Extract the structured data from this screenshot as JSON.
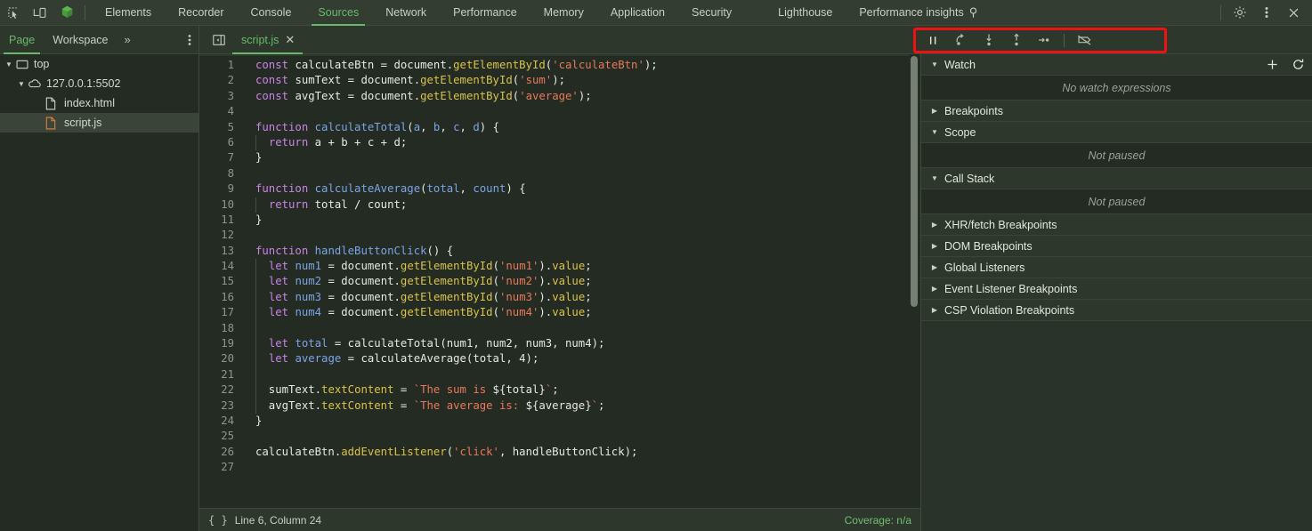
{
  "topbar": {
    "icons": [
      {
        "name": "inspect-element-icon",
        "label": "Inspect element"
      },
      {
        "name": "device-toolbar-icon",
        "label": "Toggle device toolbar"
      },
      {
        "name": "chrome-extension-hexagon-icon",
        "label": "Extension"
      }
    ],
    "tabs": [
      {
        "label": "Elements",
        "active": false
      },
      {
        "label": "Recorder",
        "active": false
      },
      {
        "label": "Console",
        "active": false
      },
      {
        "label": "Sources",
        "active": true
      },
      {
        "label": "Network",
        "active": false
      },
      {
        "label": "Performance",
        "active": false
      },
      {
        "label": "Memory",
        "active": false
      },
      {
        "label": "Application",
        "active": false
      },
      {
        "label": "Security",
        "active": false
      },
      {
        "label": "Lighthouse",
        "active": false
      },
      {
        "label": "Performance insights",
        "active": false,
        "badge": "⚲"
      }
    ],
    "right_icons": [
      {
        "name": "settings-gear-icon",
        "label": "Settings"
      },
      {
        "name": "more-options-kebab-icon",
        "label": "Customize and control DevTools"
      },
      {
        "name": "close-devtools-icon",
        "label": "Close DevTools"
      }
    ]
  },
  "navigator_tabs": {
    "tabs": [
      {
        "label": "Page",
        "active": true
      },
      {
        "label": "Workspace",
        "active": false
      }
    ],
    "overflow_label": "»",
    "more_icon": "more-options-kebab-icon"
  },
  "editor_tabs": {
    "panel_toggle_icon": "show-navigator-panel-icon",
    "open_files": [
      {
        "label": "script.js",
        "active": true,
        "close_icon": "✕"
      }
    ]
  },
  "debug_toolbar": {
    "highlighted": true,
    "highlight_color": "#ef1212",
    "buttons": [
      {
        "name": "pause-script-execution-button",
        "label": "Pause script execution",
        "glyph": "pause",
        "active": true
      },
      {
        "name": "step-over-next-function-call-button",
        "label": "Step over next function call",
        "glyph": "step-over",
        "active": false
      },
      {
        "name": "step-into-next-function-call-button",
        "label": "Step into next function call",
        "glyph": "step-into",
        "active": false
      },
      {
        "name": "step-out-of-current-function-button",
        "label": "Step out of current function",
        "glyph": "step-out",
        "active": false
      },
      {
        "name": "step-button",
        "label": "Step",
        "glyph": "step",
        "active": false
      },
      {
        "name": "deactivate-breakpoints-button",
        "label": "Deactivate breakpoints",
        "glyph": "deactivate-breakpoints",
        "active": false
      }
    ]
  },
  "navigator_tree": [
    {
      "label": "top",
      "icon": "frame-icon",
      "depth": 0,
      "twisty": "▼",
      "selected": false
    },
    {
      "label": "127.0.0.1:5502",
      "icon": "cloud-icon",
      "depth": 1,
      "twisty": "▼",
      "selected": false
    },
    {
      "label": "index.html",
      "icon": "html-file-icon",
      "depth": 2,
      "twisty": "",
      "selected": false
    },
    {
      "label": "script.js",
      "icon": "js-file-icon",
      "depth": 2,
      "twisty": "",
      "selected": true
    }
  ],
  "code": {
    "filename": "script.js",
    "total_lines": 27,
    "lines": [
      {
        "n": 1,
        "indent": 0,
        "tokens": [
          [
            "k",
            "const"
          ],
          [
            "pl",
            " "
          ],
          [
            "id",
            "calculateBtn"
          ],
          [
            "pl",
            " = "
          ],
          [
            "id",
            "document"
          ],
          [
            "pl",
            "."
          ],
          [
            "fn",
            "getElementById"
          ],
          [
            "pl",
            "("
          ],
          [
            "st",
            "'calculateBtn'"
          ],
          [
            "pl",
            ");"
          ]
        ]
      },
      {
        "n": 2,
        "indent": 0,
        "tokens": [
          [
            "k",
            "const"
          ],
          [
            "pl",
            " "
          ],
          [
            "id",
            "sumText"
          ],
          [
            "pl",
            " = "
          ],
          [
            "id",
            "document"
          ],
          [
            "pl",
            "."
          ],
          [
            "fn",
            "getElementById"
          ],
          [
            "pl",
            "("
          ],
          [
            "st",
            "'sum'"
          ],
          [
            "pl",
            ");"
          ]
        ]
      },
      {
        "n": 3,
        "indent": 0,
        "tokens": [
          [
            "k",
            "const"
          ],
          [
            "pl",
            " "
          ],
          [
            "id",
            "avgText"
          ],
          [
            "pl",
            " = "
          ],
          [
            "id",
            "document"
          ],
          [
            "pl",
            "."
          ],
          [
            "fn",
            "getElementById"
          ],
          [
            "pl",
            "("
          ],
          [
            "st",
            "'average'"
          ],
          [
            "pl",
            ");"
          ]
        ]
      },
      {
        "n": 4,
        "indent": 0,
        "tokens": []
      },
      {
        "n": 5,
        "indent": 0,
        "tokens": [
          [
            "k",
            "function"
          ],
          [
            "pl",
            " "
          ],
          [
            "vr",
            "calculateTotal"
          ],
          [
            "pl",
            "("
          ],
          [
            "vr",
            "a"
          ],
          [
            "pl",
            ", "
          ],
          [
            "vr",
            "b"
          ],
          [
            "pl",
            ", "
          ],
          [
            "vr",
            "c"
          ],
          [
            "pl",
            ", "
          ],
          [
            "vr",
            "d"
          ],
          [
            "pl",
            ") {"
          ]
        ]
      },
      {
        "n": 6,
        "indent": 1,
        "tokens": [
          [
            "pl",
            "  "
          ],
          [
            "k",
            "return"
          ],
          [
            "pl",
            " a + b + c + d;"
          ]
        ]
      },
      {
        "n": 7,
        "indent": 0,
        "tokens": [
          [
            "pl",
            "}"
          ]
        ]
      },
      {
        "n": 8,
        "indent": 0,
        "tokens": []
      },
      {
        "n": 9,
        "indent": 0,
        "tokens": [
          [
            "k",
            "function"
          ],
          [
            "pl",
            " "
          ],
          [
            "vr",
            "calculateAverage"
          ],
          [
            "pl",
            "("
          ],
          [
            "vr",
            "total"
          ],
          [
            "pl",
            ", "
          ],
          [
            "vr",
            "count"
          ],
          [
            "pl",
            ") {"
          ]
        ]
      },
      {
        "n": 10,
        "indent": 1,
        "tokens": [
          [
            "pl",
            "  "
          ],
          [
            "k",
            "return"
          ],
          [
            "pl",
            " total / count;"
          ]
        ]
      },
      {
        "n": 11,
        "indent": 0,
        "tokens": [
          [
            "pl",
            "}"
          ]
        ]
      },
      {
        "n": 12,
        "indent": 0,
        "tokens": []
      },
      {
        "n": 13,
        "indent": 0,
        "tokens": [
          [
            "k",
            "function"
          ],
          [
            "pl",
            " "
          ],
          [
            "vr",
            "handleButtonClick"
          ],
          [
            "pl",
            "() {"
          ]
        ]
      },
      {
        "n": 14,
        "indent": 1,
        "tokens": [
          [
            "pl",
            "  "
          ],
          [
            "k",
            "let"
          ],
          [
            "pl",
            " "
          ],
          [
            "vr",
            "num1"
          ],
          [
            "pl",
            " = "
          ],
          [
            "id",
            "document"
          ],
          [
            "pl",
            "."
          ],
          [
            "fn",
            "getElementById"
          ],
          [
            "pl",
            "("
          ],
          [
            "st",
            "'num1'"
          ],
          [
            "pl",
            ")."
          ],
          [
            "fn",
            "value"
          ],
          [
            "pl",
            ";"
          ]
        ]
      },
      {
        "n": 15,
        "indent": 1,
        "tokens": [
          [
            "pl",
            "  "
          ],
          [
            "k",
            "let"
          ],
          [
            "pl",
            " "
          ],
          [
            "vr",
            "num2"
          ],
          [
            "pl",
            " = "
          ],
          [
            "id",
            "document"
          ],
          [
            "pl",
            "."
          ],
          [
            "fn",
            "getElementById"
          ],
          [
            "pl",
            "("
          ],
          [
            "st",
            "'num2'"
          ],
          [
            "pl",
            ")."
          ],
          [
            "fn",
            "value"
          ],
          [
            "pl",
            ";"
          ]
        ]
      },
      {
        "n": 16,
        "indent": 1,
        "tokens": [
          [
            "pl",
            "  "
          ],
          [
            "k",
            "let"
          ],
          [
            "pl",
            " "
          ],
          [
            "vr",
            "num3"
          ],
          [
            "pl",
            " = "
          ],
          [
            "id",
            "document"
          ],
          [
            "pl",
            "."
          ],
          [
            "fn",
            "getElementById"
          ],
          [
            "pl",
            "("
          ],
          [
            "st",
            "'num3'"
          ],
          [
            "pl",
            ")."
          ],
          [
            "fn",
            "value"
          ],
          [
            "pl",
            ";"
          ]
        ]
      },
      {
        "n": 17,
        "indent": 1,
        "tokens": [
          [
            "pl",
            "  "
          ],
          [
            "k",
            "let"
          ],
          [
            "pl",
            " "
          ],
          [
            "vr",
            "num4"
          ],
          [
            "pl",
            " = "
          ],
          [
            "id",
            "document"
          ],
          [
            "pl",
            "."
          ],
          [
            "fn",
            "getElementById"
          ],
          [
            "pl",
            "("
          ],
          [
            "st",
            "'num4'"
          ],
          [
            "pl",
            ")."
          ],
          [
            "fn",
            "value"
          ],
          [
            "pl",
            ";"
          ]
        ]
      },
      {
        "n": 18,
        "indent": 1,
        "tokens": []
      },
      {
        "n": 19,
        "indent": 1,
        "tokens": [
          [
            "pl",
            "  "
          ],
          [
            "k",
            "let"
          ],
          [
            "pl",
            " "
          ],
          [
            "vr",
            "total"
          ],
          [
            "pl",
            " = calculateTotal(num1, num2, num3, num4);"
          ]
        ]
      },
      {
        "n": 20,
        "indent": 1,
        "tokens": [
          [
            "pl",
            "  "
          ],
          [
            "k",
            "let"
          ],
          [
            "pl",
            " "
          ],
          [
            "vr",
            "average"
          ],
          [
            "pl",
            " = calculateAverage(total, 4);"
          ]
        ]
      },
      {
        "n": 21,
        "indent": 1,
        "tokens": []
      },
      {
        "n": 22,
        "indent": 1,
        "tokens": [
          [
            "pl",
            "  sumText."
          ],
          [
            "fn",
            "textContent"
          ],
          [
            "pl",
            " = "
          ],
          [
            "st",
            "`The sum is "
          ],
          [
            "pl",
            "${total}"
          ],
          [
            "st",
            "`"
          ],
          [
            "pl",
            ";"
          ]
        ]
      },
      {
        "n": 23,
        "indent": 1,
        "tokens": [
          [
            "pl",
            "  avgText."
          ],
          [
            "fn",
            "textContent"
          ],
          [
            "pl",
            " = "
          ],
          [
            "st",
            "`The average is: "
          ],
          [
            "pl",
            "${average}"
          ],
          [
            "st",
            "`"
          ],
          [
            "pl",
            ";"
          ]
        ]
      },
      {
        "n": 24,
        "indent": 0,
        "tokens": [
          [
            "pl",
            "}"
          ]
        ]
      },
      {
        "n": 25,
        "indent": 0,
        "tokens": []
      },
      {
        "n": 26,
        "indent": 0,
        "tokens": [
          [
            "pl",
            "calculateBtn."
          ],
          [
            "fn",
            "addEventListener"
          ],
          [
            "pl",
            "("
          ],
          [
            "st",
            "'click'"
          ],
          [
            "pl",
            ", handleButtonClick);"
          ]
        ]
      },
      {
        "n": 27,
        "indent": 0,
        "tokens": []
      }
    ]
  },
  "statusbar": {
    "pretty_print_icon": "{ }",
    "position": "Line 6, Column 24",
    "coverage": "Coverage: n/a"
  },
  "debugger_panel": {
    "sections": [
      {
        "name": "watch",
        "label": "Watch",
        "twisty": "▼",
        "expanded": true,
        "actions": [
          {
            "name": "add-watch-expression-button",
            "glyph": "plus"
          },
          {
            "name": "refresh-watch-expressions-button",
            "glyph": "refresh"
          }
        ],
        "empty_text": "No watch expressions"
      },
      {
        "name": "breakpoints",
        "label": "Breakpoints",
        "twisty": "▶",
        "expanded": false
      },
      {
        "name": "scope",
        "label": "Scope",
        "twisty": "▼",
        "expanded": true,
        "empty_text": "Not paused"
      },
      {
        "name": "call-stack",
        "label": "Call Stack",
        "twisty": "▼",
        "expanded": true,
        "empty_text": "Not paused"
      },
      {
        "name": "xhr-fetch-breakpoints",
        "label": "XHR/fetch Breakpoints",
        "twisty": "▶",
        "expanded": false
      },
      {
        "name": "dom-breakpoints",
        "label": "DOM Breakpoints",
        "twisty": "▶",
        "expanded": false
      },
      {
        "name": "global-listeners",
        "label": "Global Listeners",
        "twisty": "▶",
        "expanded": false
      },
      {
        "name": "event-listener-breakpoints",
        "label": "Event Listener Breakpoints",
        "twisty": "▶",
        "expanded": false
      },
      {
        "name": "csp-violation-breakpoints",
        "label": "CSP Violation Breakpoints",
        "twisty": "▶",
        "expanded": false
      }
    ]
  },
  "colors": {
    "accent_green": "#68b96a",
    "highlight_red": "#ef1212",
    "bg_dark": "#242b22",
    "bg_bar": "#333d31"
  }
}
